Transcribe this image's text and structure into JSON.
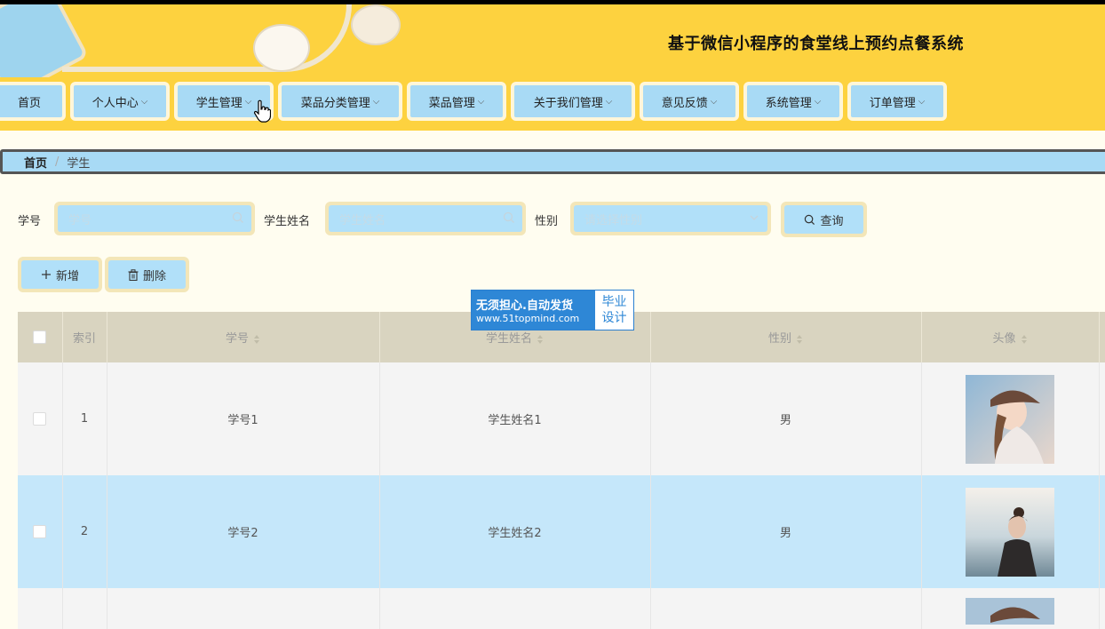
{
  "header": {
    "title": "基于微信小程序的食堂线上预约点餐系统"
  },
  "nav": {
    "items": [
      {
        "label": "首页",
        "has_dropdown": false
      },
      {
        "label": "个人中心",
        "has_dropdown": true
      },
      {
        "label": "学生管理",
        "has_dropdown": true
      },
      {
        "label": "菜品分类管理",
        "has_dropdown": true
      },
      {
        "label": "菜品管理",
        "has_dropdown": true
      },
      {
        "label": "关于我们管理",
        "has_dropdown": true
      },
      {
        "label": "意见反馈",
        "has_dropdown": true
      },
      {
        "label": "系统管理",
        "has_dropdown": true
      },
      {
        "label": "订单管理",
        "has_dropdown": true
      }
    ]
  },
  "breadcrumb": {
    "home": "首页",
    "separator": "/",
    "current": "学生"
  },
  "search": {
    "student_no_label": "学号",
    "student_no_placeholder": "学号",
    "student_name_label": "学生姓名",
    "student_name_placeholder": "学生姓名",
    "gender_label": "性别",
    "gender_placeholder": "请选择性别",
    "query_button": "查询"
  },
  "actions": {
    "add_button": "新增",
    "delete_button": "删除"
  },
  "watermark": {
    "line1": "无须担心.自动发货",
    "line2": "www.51topmind.com",
    "right1": "毕业",
    "right2": "设计"
  },
  "table": {
    "columns": [
      "索引",
      "学号",
      "学生姓名",
      "性别",
      "头像"
    ],
    "rows": [
      {
        "index": "1",
        "student_no": "学号1",
        "student_name": "学生姓名1",
        "gender": "男",
        "avatar": "avatar-photo-cap"
      },
      {
        "index": "2",
        "student_no": "学号2",
        "student_name": "学生姓名2",
        "gender": "男",
        "avatar": "avatar-photo-sea"
      }
    ]
  },
  "colors": {
    "header_bg": "#fdd23f",
    "button_bg": "#b1e0f9",
    "page_bg": "#fffdf0",
    "table_header_bg": "#d9d4c0",
    "row_highlight": "#c5e7fa"
  }
}
